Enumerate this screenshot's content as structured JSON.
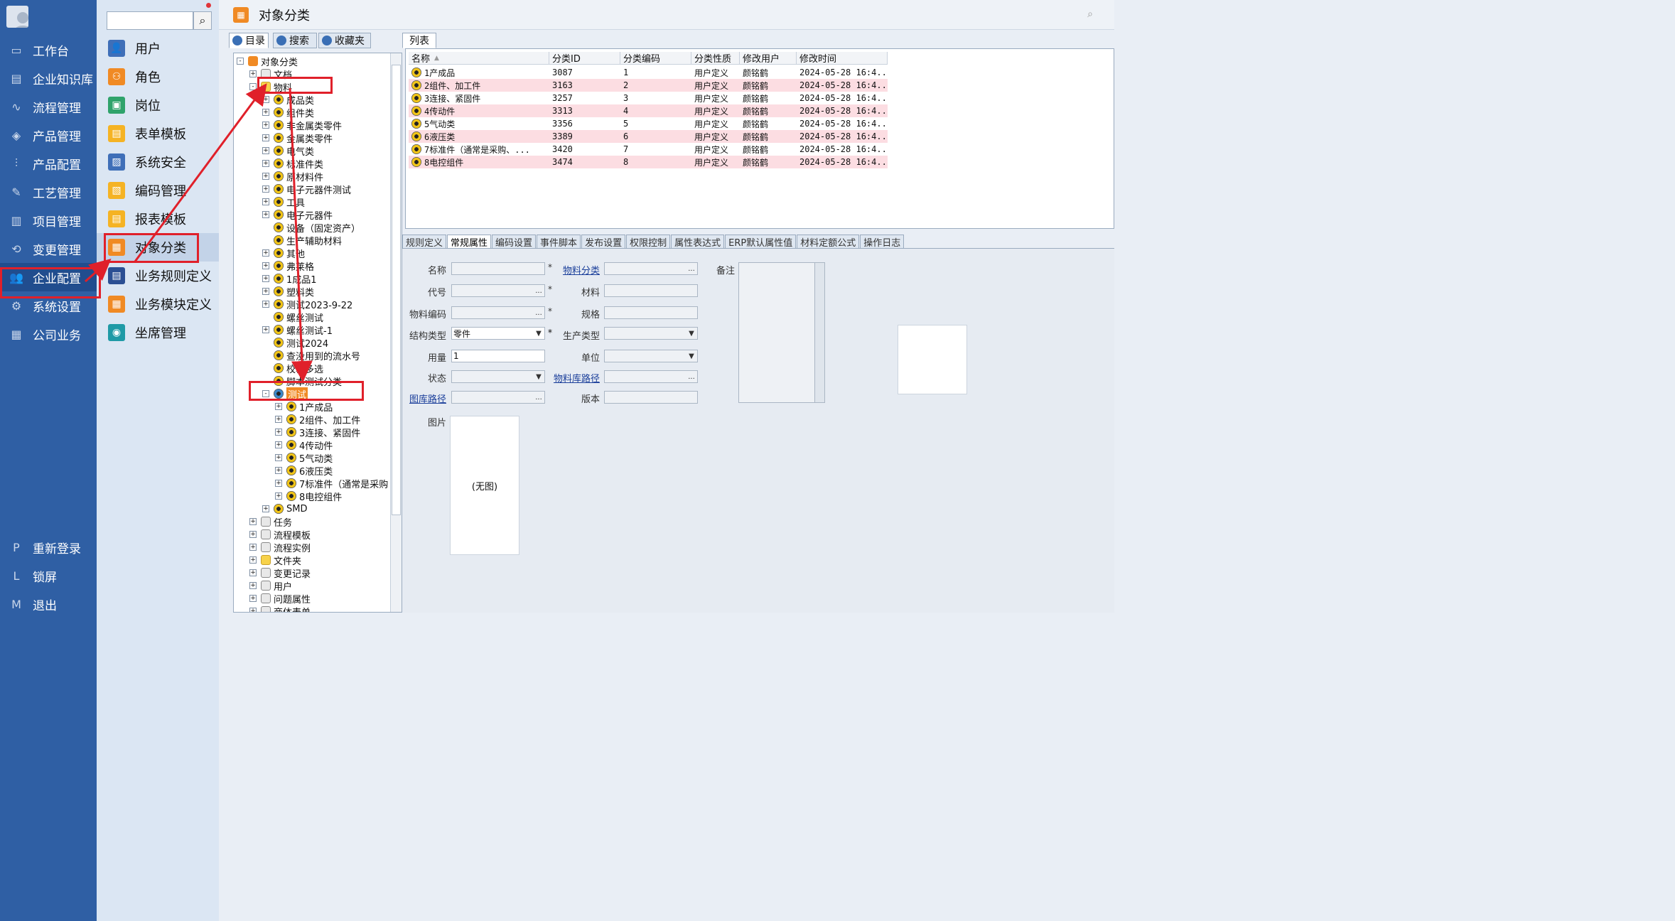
{
  "nav": {
    "items": [
      {
        "label": "工作台",
        "icon": "monitor-icon"
      },
      {
        "label": "企业知识库",
        "icon": "library-icon"
      },
      {
        "label": "流程管理",
        "icon": "flow-icon"
      },
      {
        "label": "产品管理",
        "icon": "cube-icon"
      },
      {
        "label": "产品配置",
        "icon": "sliders-icon"
      },
      {
        "label": "工艺管理",
        "icon": "wrench-icon"
      },
      {
        "label": "项目管理",
        "icon": "chart-icon"
      },
      {
        "label": "变更管理",
        "icon": "change-icon"
      },
      {
        "label": "企业配置",
        "icon": "users-icon"
      },
      {
        "label": "系统设置",
        "icon": "gear-icon"
      },
      {
        "label": "公司业务",
        "icon": "grid-icon"
      }
    ],
    "active_index": 8,
    "bottom": [
      {
        "key": "P",
        "label": "重新登录"
      },
      {
        "key": "L",
        "label": "锁屏"
      },
      {
        "key": "M",
        "label": "退出"
      }
    ]
  },
  "subnav": {
    "search_placeholder": "",
    "items": [
      {
        "label": "用户",
        "color": "blue"
      },
      {
        "label": "角色",
        "color": "orange"
      },
      {
        "label": "岗位",
        "color": "green"
      },
      {
        "label": "表单模板",
        "color": "yellow"
      },
      {
        "label": "系统安全",
        "color": "blue"
      },
      {
        "label": "编码管理",
        "color": "yellow"
      },
      {
        "label": "报表模板",
        "color": "yellow"
      },
      {
        "label": "对象分类",
        "color": "orange"
      },
      {
        "label": "业务规则定义",
        "color": "navy"
      },
      {
        "label": "业务模块定义",
        "color": "orange"
      },
      {
        "label": "坐席管理",
        "color": "teal"
      }
    ],
    "active_index": 7
  },
  "main": {
    "title": "对象分类"
  },
  "tree_tabs": [
    "目录",
    "搜索",
    "收藏夹"
  ],
  "tree": [
    {
      "label": "对象分类",
      "depth": 0,
      "exp": "-",
      "icon": "grid"
    },
    {
      "label": "文档",
      "depth": 1,
      "exp": "+",
      "icon": "doc"
    },
    {
      "label": "物料",
      "depth": 1,
      "exp": "-",
      "icon": "folder"
    },
    {
      "label": "成品类",
      "depth": 2,
      "exp": "+",
      "icon": "gear"
    },
    {
      "label": "组件类",
      "depth": 2,
      "exp": "+",
      "icon": "gear"
    },
    {
      "label": "非金属类零件",
      "depth": 2,
      "exp": "+",
      "icon": "gear"
    },
    {
      "label": "金属类零件",
      "depth": 2,
      "exp": "+",
      "icon": "gear"
    },
    {
      "label": "电气类",
      "depth": 2,
      "exp": "+",
      "icon": "gear"
    },
    {
      "label": "标准件类",
      "depth": 2,
      "exp": "+",
      "icon": "gear"
    },
    {
      "label": "原材料件",
      "depth": 2,
      "exp": "+",
      "icon": "gear"
    },
    {
      "label": "电子元器件测试",
      "depth": 2,
      "exp": "+",
      "icon": "gear"
    },
    {
      "label": "工具",
      "depth": 2,
      "exp": "+",
      "icon": "gear"
    },
    {
      "label": "电子元器件",
      "depth": 2,
      "exp": "+",
      "icon": "gear"
    },
    {
      "label": "设备（固定资产）",
      "depth": 2,
      "exp": "",
      "icon": "gear"
    },
    {
      "label": "生产辅助材料",
      "depth": 2,
      "exp": "",
      "icon": "gear"
    },
    {
      "label": "其他",
      "depth": 2,
      "exp": "+",
      "icon": "gear"
    },
    {
      "label": "弗莱格",
      "depth": 2,
      "exp": "+",
      "icon": "gear"
    },
    {
      "label": "1成品1",
      "depth": 2,
      "exp": "+",
      "icon": "gear"
    },
    {
      "label": "塑料类",
      "depth": 2,
      "exp": "+",
      "icon": "gear"
    },
    {
      "label": "测试2023-9-22",
      "depth": 2,
      "exp": "+",
      "icon": "gear"
    },
    {
      "label": "螺丝测试",
      "depth": 2,
      "exp": "",
      "icon": "gear"
    },
    {
      "label": "螺丝测试-1",
      "depth": 2,
      "exp": "+",
      "icon": "gear"
    },
    {
      "label": "测试2024",
      "depth": 2,
      "exp": "",
      "icon": "gear"
    },
    {
      "label": "查没用到的流水号",
      "depth": 2,
      "exp": "",
      "icon": "gear"
    },
    {
      "label": "校验多选",
      "depth": 2,
      "exp": "",
      "icon": "gear"
    },
    {
      "label": "脚本测试分类",
      "depth": 2,
      "exp": "",
      "icon": "gear"
    },
    {
      "label": "测试",
      "depth": 2,
      "exp": "-",
      "icon": "sel",
      "highlight": true
    },
    {
      "label": "1产成品",
      "depth": 3,
      "exp": "+",
      "icon": "gear"
    },
    {
      "label": "2组件、加工件",
      "depth": 3,
      "exp": "+",
      "icon": "gear"
    },
    {
      "label": "3连接、紧固件",
      "depth": 3,
      "exp": "+",
      "icon": "gear"
    },
    {
      "label": "4传动件",
      "depth": 3,
      "exp": "+",
      "icon": "gear"
    },
    {
      "label": "5气动类",
      "depth": 3,
      "exp": "+",
      "icon": "gear"
    },
    {
      "label": "6液压类",
      "depth": 3,
      "exp": "+",
      "icon": "gear"
    },
    {
      "label": "7标准件（通常是采购",
      "depth": 3,
      "exp": "+",
      "icon": "gear"
    },
    {
      "label": "8电控组件",
      "depth": 3,
      "exp": "+",
      "icon": "gear"
    },
    {
      "label": "SMD",
      "depth": 2,
      "exp": "+",
      "icon": "gear"
    },
    {
      "label": "任务",
      "depth": 1,
      "exp": "+",
      "icon": "doc"
    },
    {
      "label": "流程模板",
      "depth": 1,
      "exp": "+",
      "icon": "doc"
    },
    {
      "label": "流程实例",
      "depth": 1,
      "exp": "+",
      "icon": "doc"
    },
    {
      "label": "文件夹",
      "depth": 1,
      "exp": "+",
      "icon": "folder"
    },
    {
      "label": "变更记录",
      "depth": 1,
      "exp": "+",
      "icon": "doc"
    },
    {
      "label": "用户",
      "depth": 1,
      "exp": "+",
      "icon": "doc"
    },
    {
      "label": "问题属性",
      "depth": 1,
      "exp": "+",
      "icon": "doc"
    },
    {
      "label": "商体表单",
      "depth": 1,
      "exp": "+",
      "icon": "doc"
    }
  ],
  "list_tab": "列表",
  "grid": {
    "columns": [
      "名称",
      "分类ID",
      "分类编码",
      "分类性质",
      "修改用户",
      "修改时间"
    ],
    "rows": [
      {
        "name": "1产成品",
        "id": "3087",
        "code": "1",
        "nature": "用户定义",
        "user": "颜铭鹤",
        "time": "2024-05-28 16:4...",
        "pink": false
      },
      {
        "name": "2组件、加工件",
        "id": "3163",
        "code": "2",
        "nature": "用户定义",
        "user": "颜铭鹤",
        "time": "2024-05-28 16:4...",
        "pink": true
      },
      {
        "name": "3连接、紧固件",
        "id": "3257",
        "code": "3",
        "nature": "用户定义",
        "user": "颜铭鹤",
        "time": "2024-05-28 16:4...",
        "pink": false
      },
      {
        "name": "4传动件",
        "id": "3313",
        "code": "4",
        "nature": "用户定义",
        "user": "颜铭鹤",
        "time": "2024-05-28 16:4...",
        "pink": true
      },
      {
        "name": "5气动类",
        "id": "3356",
        "code": "5",
        "nature": "用户定义",
        "user": "颜铭鹤",
        "time": "2024-05-28 16:4...",
        "pink": false
      },
      {
        "name": "6液压类",
        "id": "3389",
        "code": "6",
        "nature": "用户定义",
        "user": "颜铭鹤",
        "time": "2024-05-28 16:4...",
        "pink": true
      },
      {
        "name": "7标准件（通常是采购、...",
        "id": "3420",
        "code": "7",
        "nature": "用户定义",
        "user": "颜铭鹤",
        "time": "2024-05-28 16:4...",
        "pink": false
      },
      {
        "name": "8电控组件",
        "id": "3474",
        "code": "8",
        "nature": "用户定义",
        "user": "颜铭鹤",
        "time": "2024-05-28 16:4...",
        "pink": true
      }
    ]
  },
  "prop_tabs": [
    "规则定义",
    "常规属性",
    "编码设置",
    "事件脚本",
    "发布设置",
    "权限控制",
    "属性表达式",
    "ERP默认属性值",
    "材料定额公式",
    "操作日志"
  ],
  "prop_active": 1,
  "form": {
    "name_label": "名称",
    "code_label": "代号",
    "matcode_label": "物料编码",
    "struct_label": "结构类型",
    "struct_value": "零件",
    "qty_label": "用量",
    "qty_value": "1",
    "status_label": "状态",
    "lib_label": "图库路径",
    "matcat_label": "物料分类",
    "material_label": "材料",
    "spec_label": "规格",
    "prodtype_label": "生产类型",
    "unit_label": "单位",
    "matlib_label": "物料库路径",
    "version_label": "版本",
    "remark_label": "备注",
    "pic_label": "图片",
    "pic_value": "(无图)",
    "star": "*",
    "ellipsis": "...",
    "dropdown": "▼"
  },
  "colors": {
    "nav_bg": "#2f5fa4",
    "accent_orange": "#f08a24",
    "annot_red": "#e0202a",
    "row_pink": "#fcdde2"
  }
}
